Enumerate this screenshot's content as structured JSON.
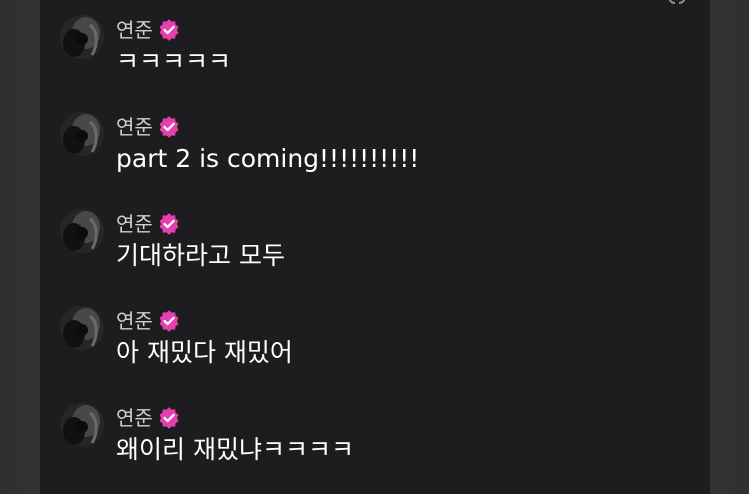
{
  "colors": {
    "panel": "#1d1d1f",
    "badge": "#e63fb0",
    "name": "#d0d0d4",
    "text": "#ffffff"
  },
  "messages": [
    {
      "author": "연준",
      "verified_icon": "verified-badge-icon",
      "text": "ㅋㅋㅋㅋㅋ"
    },
    {
      "author": "연준",
      "verified_icon": "verified-badge-icon",
      "text": "part 2 is coming!!!!!!!!!!"
    },
    {
      "author": "연준",
      "verified_icon": "verified-badge-icon",
      "text": "기대하라고 모두"
    },
    {
      "author": "연준",
      "verified_icon": "verified-badge-icon",
      "text": "아 재밌다 재밌어"
    },
    {
      "author": "연준",
      "verified_icon": "verified-badge-icon",
      "text": "왜이리 재밌냐ㅋㅋㅋㅋ"
    }
  ]
}
